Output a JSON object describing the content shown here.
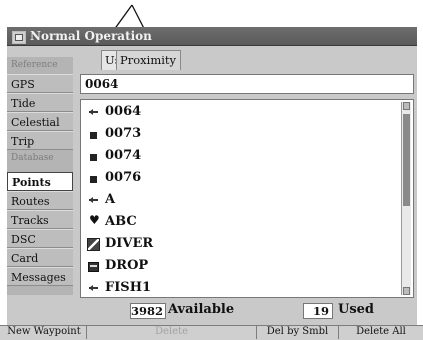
{
  "window": {
    "title": "Normal Operation"
  },
  "sidebar": {
    "items": [
      {
        "label": "Reference",
        "kind": "heading"
      },
      {
        "label": "GPS",
        "kind": "item"
      },
      {
        "label": "Tide",
        "kind": "item"
      },
      {
        "label": "Celestial",
        "kind": "item"
      },
      {
        "label": "Trip",
        "kind": "item"
      },
      {
        "label": "Database",
        "kind": "heading"
      },
      {
        "label": "Points",
        "kind": "item",
        "selected": true
      },
      {
        "label": "Routes",
        "kind": "item"
      },
      {
        "label": "Tracks",
        "kind": "item"
      },
      {
        "label": "DSC",
        "kind": "item"
      },
      {
        "label": "Card",
        "kind": "item"
      },
      {
        "label": "Messages",
        "kind": "item"
      }
    ]
  },
  "tabs": [
    {
      "label": "User"
    },
    {
      "label": "Proximity"
    }
  ],
  "search": {
    "value": "0064"
  },
  "list": {
    "items": [
      {
        "label": "0064",
        "icon": "flag-icon"
      },
      {
        "label": "0073",
        "icon": "square-icon"
      },
      {
        "label": "0074",
        "icon": "square-icon"
      },
      {
        "label": "0076",
        "icon": "square-icon"
      },
      {
        "label": "A",
        "icon": "flag-icon"
      },
      {
        "label": "ABC",
        "icon": "heart-icon"
      },
      {
        "label": "DIVER",
        "icon": "diver-flag-icon"
      },
      {
        "label": "DROP",
        "icon": "drop-icon"
      },
      {
        "label": "FISH1",
        "icon": "flag-icon"
      }
    ]
  },
  "status": {
    "available_count": "3982",
    "available_label": "Available",
    "used_count": "19",
    "used_label": "Used"
  },
  "softkeys": [
    {
      "label": "New Waypoint",
      "enabled": true
    },
    {
      "label": "Delete",
      "enabled": false
    },
    {
      "label": "Del by Smbl",
      "enabled": true
    },
    {
      "label": "Delete All",
      "enabled": true
    }
  ],
  "colors": {
    "title_bar": "#5e5e5e",
    "panel": "#c9c9c9",
    "sidebar": "#b4b4b4",
    "selection": "#ffffff"
  }
}
